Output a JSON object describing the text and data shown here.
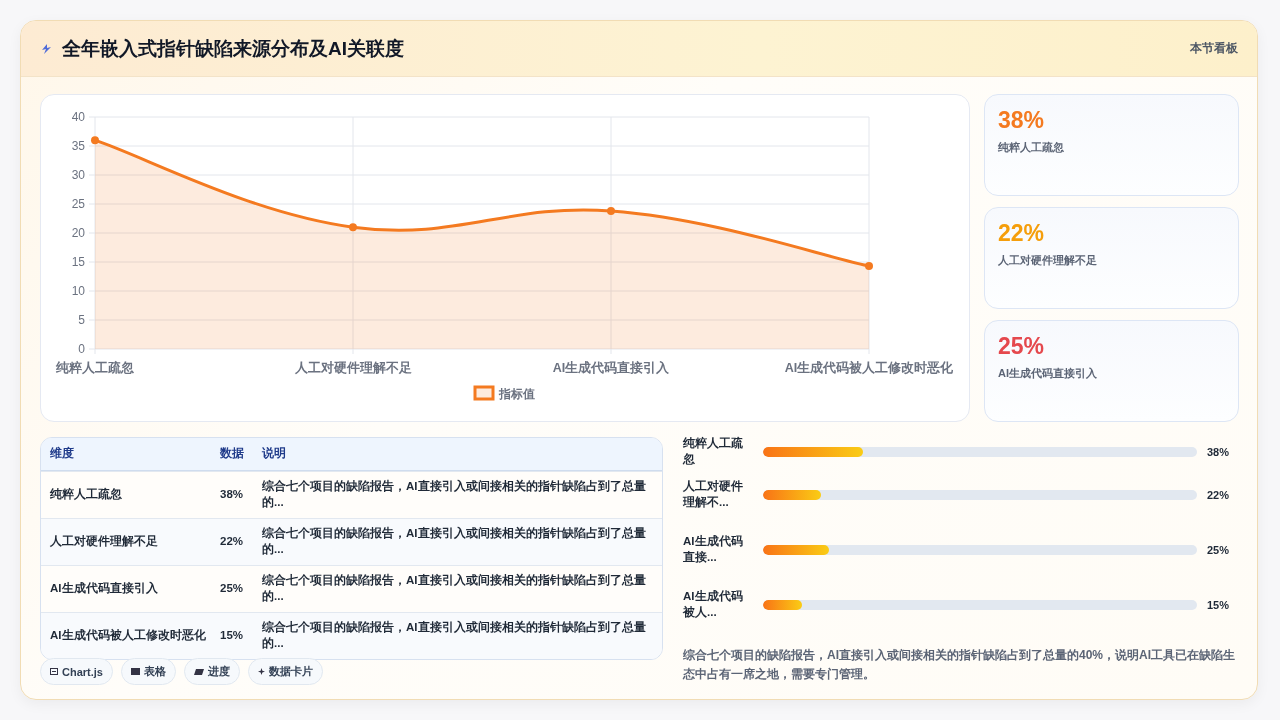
{
  "header": {
    "title": "全年嵌入式指针缺陷来源分布及AI关联度",
    "link": "本节看板"
  },
  "chart": {
    "chart_data": {
      "type": "area",
      "categories": [
        "纯粹人工疏忽",
        "人工对硬件理解不足",
        "AI生成代码直接引入",
        "AI生成代码被人工修改时恶化"
      ],
      "series": [
        {
          "name": "指标值",
          "color": "#f47a20",
          "values": [
            36,
            21,
            23.8,
            14.3
          ]
        }
      ],
      "ylim": [
        0,
        40
      ],
      "yticks": [
        0,
        5,
        10,
        15,
        20,
        25,
        30,
        35,
        40
      ],
      "grid": true
    }
  },
  "stat_cards": [
    {
      "value": "38%",
      "label": "纯粹人工疏忽",
      "color": "#f47a20"
    },
    {
      "value": "22%",
      "label": "人工对硬件理解不足",
      "color": "#f59e0b"
    },
    {
      "value": "25%",
      "label": "AI生成代码直接引入",
      "color": "#e5484d"
    }
  ],
  "table": {
    "columns": [
      "维度",
      "数据",
      "说明"
    ],
    "rows": [
      [
        "纯粹人工疏忽",
        "38%",
        "综合七个项目的缺陷报告，AI直接引入或间接相关的指针缺陷占到了总量的..."
      ],
      [
        "人工对硬件理解不足",
        "22%",
        "综合七个项目的缺陷报告，AI直接引入或间接相关的指针缺陷占到了总量的..."
      ],
      [
        "AI生成代码直接引入",
        "25%",
        "综合七个项目的缺陷报告，AI直接引入或间接相关的指针缺陷占到了总量的..."
      ],
      [
        "AI生成代码被人工修改时恶化",
        "15%",
        "综合七个项目的缺陷报告，AI直接引入或间接相关的指针缺陷占到了总量的..."
      ]
    ]
  },
  "progress": [
    {
      "label": "纯粹人工疏忽",
      "level": 0.23,
      "reading": "38%"
    },
    {
      "label": "人工对硬件理解不...",
      "level": 0.134,
      "reading": "22%"
    },
    {
      "label": "AI生成代码直接...",
      "level": 0.152,
      "reading": "25%"
    },
    {
      "label": "AI生成代码被人...",
      "level": 0.091,
      "reading": "15%"
    }
  ],
  "summary": "综合七个项目的缺陷报告，AI直接引入或间接相关的指针缺陷占到了总量的40%，说明AI工具已在缺陷生态中占有一席之地，需要专门管理。",
  "chips": [
    {
      "kind": "chart",
      "label": "Chart.js"
    },
    {
      "kind": "table",
      "label": "表格"
    },
    {
      "kind": "progress",
      "label": "进度"
    },
    {
      "kind": "cards",
      "label": "数据卡片"
    }
  ]
}
